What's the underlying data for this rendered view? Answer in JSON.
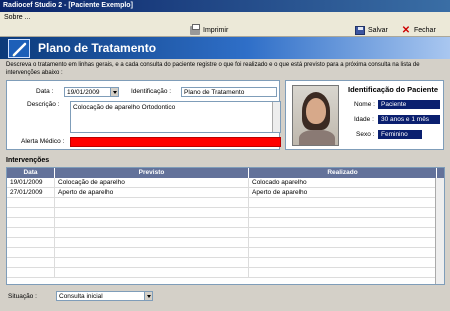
{
  "window": {
    "title": "Radiocef Studio 2 - [Paciente Exemplo]"
  },
  "menu": {
    "about": "Sobre ..."
  },
  "toolbar": {
    "print_label": "Imprimir",
    "save_label": "Salvar",
    "close_label": "Fechar"
  },
  "header": {
    "title": "Plano de Tratamento"
  },
  "instructions": "Descreva o tratamento em linhas gerais, e a cada consulta do paciente registre o que foi realizado e o que está previsto para a próxima consulta na lista de intervenções abaixo :",
  "form": {
    "date_label": "Data :",
    "date_value": "19/01/2009",
    "identification_label": "Identificação :",
    "identification_value": "Plano de Tratamento",
    "description_label": "Descrição :",
    "description_value": "Colocação de aparelho Ortodontico",
    "medical_alert_label": "Alerta Médico :",
    "medical_alert_color": "#ff0000"
  },
  "patient": {
    "title": "Identificação do Paciente",
    "name_label": "Nome :",
    "name_value": "Paciente",
    "age_label": "Idade :",
    "age_value": "30 anos e 1 mês",
    "sex_label": "Sexo :",
    "sex_value": "Feminino"
  },
  "interventions": {
    "title": "Intervenções",
    "columns": [
      "Data",
      "Previsto",
      "Realizado"
    ],
    "rows": [
      {
        "date": "19/01/2009",
        "planned": "Colocação de aparelho",
        "done": "Colocado aparelho"
      },
      {
        "date": "27/01/2009",
        "planned": "Aperto de aparelho",
        "done": "Aperto de aparelho"
      }
    ]
  },
  "status": {
    "label": "Situação :",
    "value": "Consulta inicial"
  },
  "colors": {
    "accent": "#0a246a",
    "header_bg": "#63729a",
    "badge_bg": "#0a1f6f"
  }
}
